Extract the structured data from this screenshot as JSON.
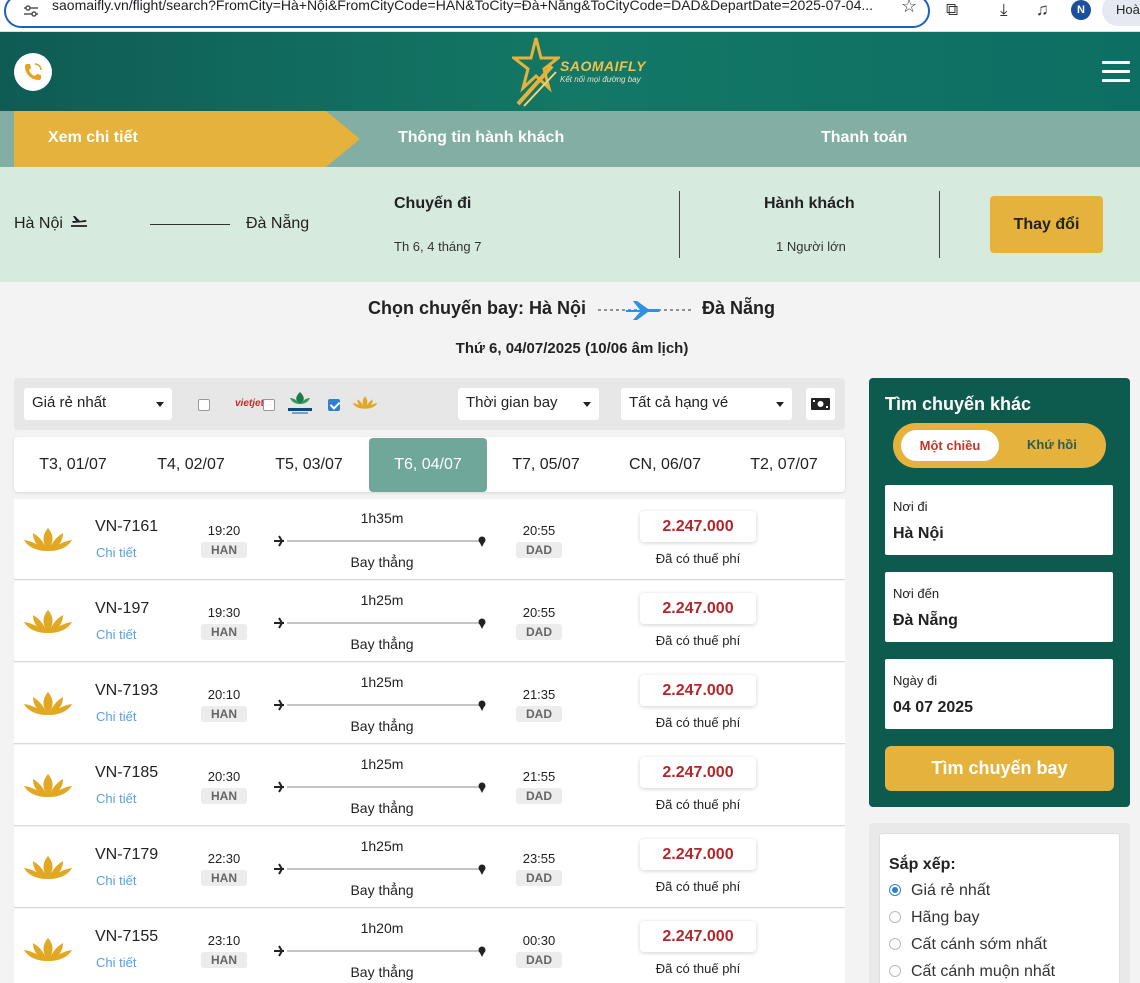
{
  "browser": {
    "url": "saomaifly.vn/flight/search?FromCity=Hà+Nội&FromCityCode=HAN&ToCity=Đà+Nẵng&ToCityCode=DAD&DepartDate=2025-07-04...",
    "profile_initial": "N",
    "profile_name": "Hoàn"
  },
  "header": {
    "logo_text": "SAOMAIFLY",
    "logo_tagline": "Kết nối mọi đường bay"
  },
  "steps": [
    "Xem chi tiết",
    "Thông tin hành khách",
    "Thanh toán"
  ],
  "summary": {
    "from": "Hà Nội",
    "to": "Đà Nẵng",
    "trip_label": "Chuyến đi",
    "trip_date": "Th 6, 4 tháng 7",
    "pax_label": "Hành khách",
    "pax_value": "1 Người lớn",
    "change_button": "Thay đổi"
  },
  "choose": {
    "prefix": "Chọn chuyến bay: Hà Nội",
    "to": "Đà Nẵng",
    "date_line": "Thứ 6, 04/07/2025 (10/06 âm lịch)"
  },
  "filters": {
    "sort_select": "Giá rẻ nhất",
    "time_select": "Thời gian bay",
    "class_select": "Tất cả hạng vé",
    "vietjet_label": "vietjet",
    "vietjet_checked": false,
    "bamboo_checked": false,
    "vna_checked": true
  },
  "date_tabs": [
    {
      "label": "T3, 01/07",
      "active": false
    },
    {
      "label": "T4, 02/07",
      "active": false
    },
    {
      "label": "T5, 03/07",
      "active": false
    },
    {
      "label": "T6, 04/07",
      "active": true
    },
    {
      "label": "T7, 05/07",
      "active": false
    },
    {
      "label": "CN, 06/07",
      "active": false
    },
    {
      "label": "T2, 07/07",
      "active": false
    }
  ],
  "flight_common": {
    "detail_link": "Chi tiết",
    "origin_code": "HAN",
    "dest_code": "DAD",
    "flight_type": "Bay thẳng",
    "tax_note": "Đã có thuế phí"
  },
  "flights": [
    {
      "code": "VN-7161",
      "depart": "19:20",
      "duration": "1h35m",
      "arrive": "20:55",
      "price": "2.247.000"
    },
    {
      "code": "VN-197",
      "depart": "19:30",
      "duration": "1h25m",
      "arrive": "20:55",
      "price": "2.247.000"
    },
    {
      "code": "VN-7193",
      "depart": "20:10",
      "duration": "1h25m",
      "arrive": "21:35",
      "price": "2.247.000"
    },
    {
      "code": "VN-7185",
      "depart": "20:30",
      "duration": "1h25m",
      "arrive": "21:55",
      "price": "2.247.000"
    },
    {
      "code": "VN-7179",
      "depart": "22:30",
      "duration": "1h25m",
      "arrive": "23:55",
      "price": "2.247.000"
    },
    {
      "code": "VN-7155",
      "depart": "23:10",
      "duration": "1h20m",
      "arrive": "00:30",
      "price": "2.247.000"
    }
  ],
  "search_panel": {
    "title": "Tìm chuyến khác",
    "one_way": "Một chiều",
    "round_trip": "Khứ hồi",
    "from_label": "Nơi đi",
    "from_value": "Hà Nội",
    "to_label": "Nơi đến",
    "to_value": "Đà Nẵng",
    "date_label": "Ngày đi",
    "date_value": "04 07 2025",
    "search_button": "Tìm chuyến bay"
  },
  "sort_panel": {
    "title": "Sắp xếp:",
    "options": [
      {
        "label": "Giá rẻ nhất",
        "selected": true
      },
      {
        "label": "Hãng bay",
        "selected": false
      },
      {
        "label": "Cất cánh sớm nhất",
        "selected": false
      },
      {
        "label": "Cất cánh muộn nhất",
        "selected": false
      }
    ]
  },
  "colors": {
    "brand_green": "#0f5c55",
    "accent_gold": "#e5b23b",
    "price_red": "#b3262a",
    "active_tab": "#6fa89b"
  }
}
